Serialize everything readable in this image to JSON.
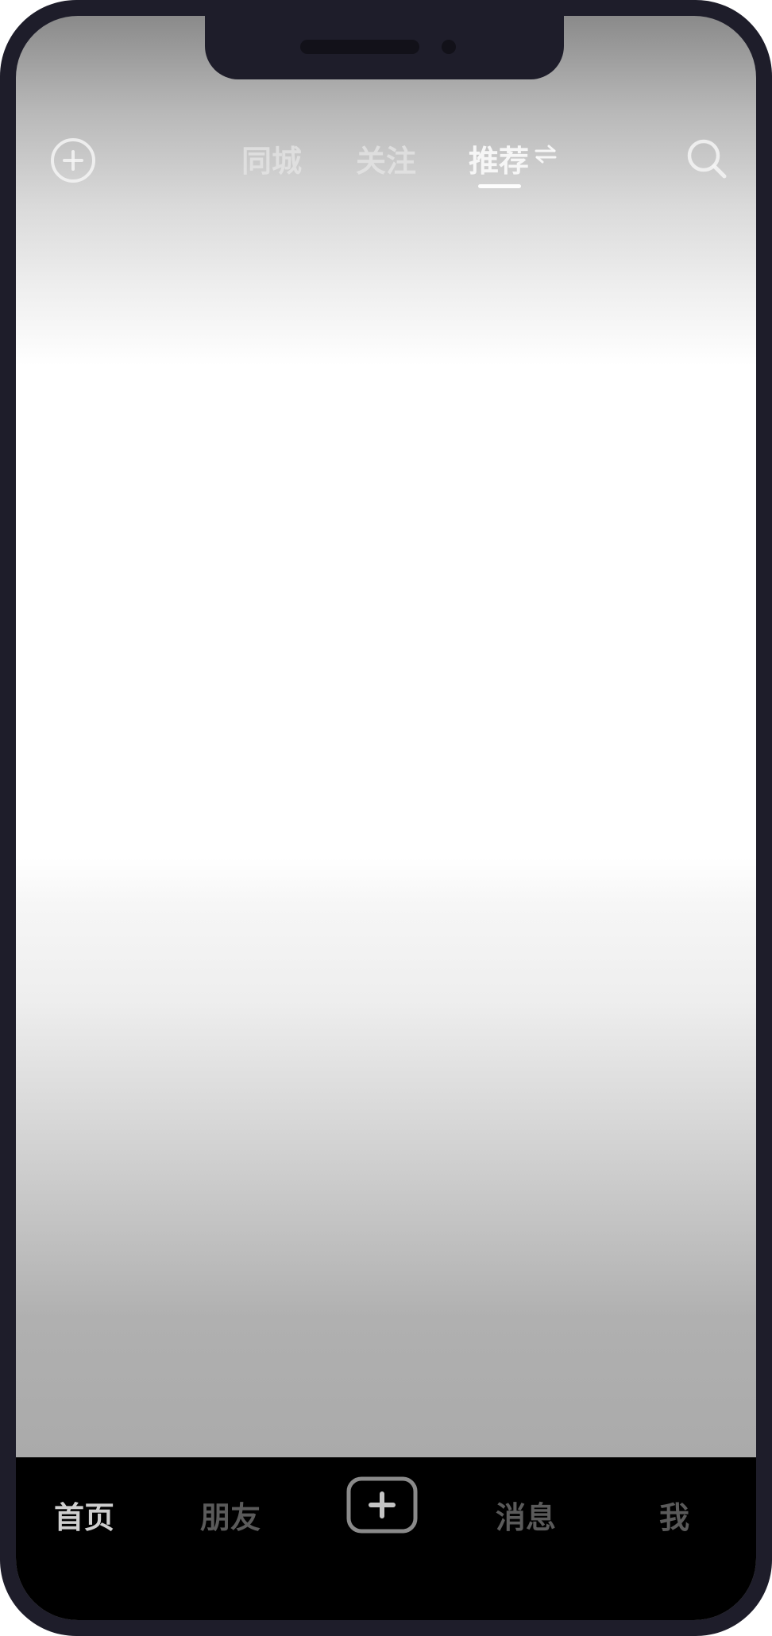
{
  "top_bar": {
    "left_icon": "plus-circle-icon",
    "tabs": [
      {
        "label": "同城",
        "active": false
      },
      {
        "label": "关注",
        "active": false
      },
      {
        "label": "推荐",
        "active": true
      }
    ],
    "switch_icon": "swap-arrows-icon",
    "right_icon": "search-icon"
  },
  "bottom_nav": {
    "items": [
      {
        "label": "首页",
        "active": true
      },
      {
        "label": "朋友",
        "active": false
      },
      {
        "label": "",
        "icon": "plus-square-icon"
      },
      {
        "label": "消息",
        "active": false
      },
      {
        "label": "我",
        "active": false
      }
    ]
  },
  "colors": {
    "frame": "#1e1d2a",
    "nav_background": "#000000",
    "nav_active": "#cfcfcf",
    "nav_inactive": "#5a5a5a"
  }
}
